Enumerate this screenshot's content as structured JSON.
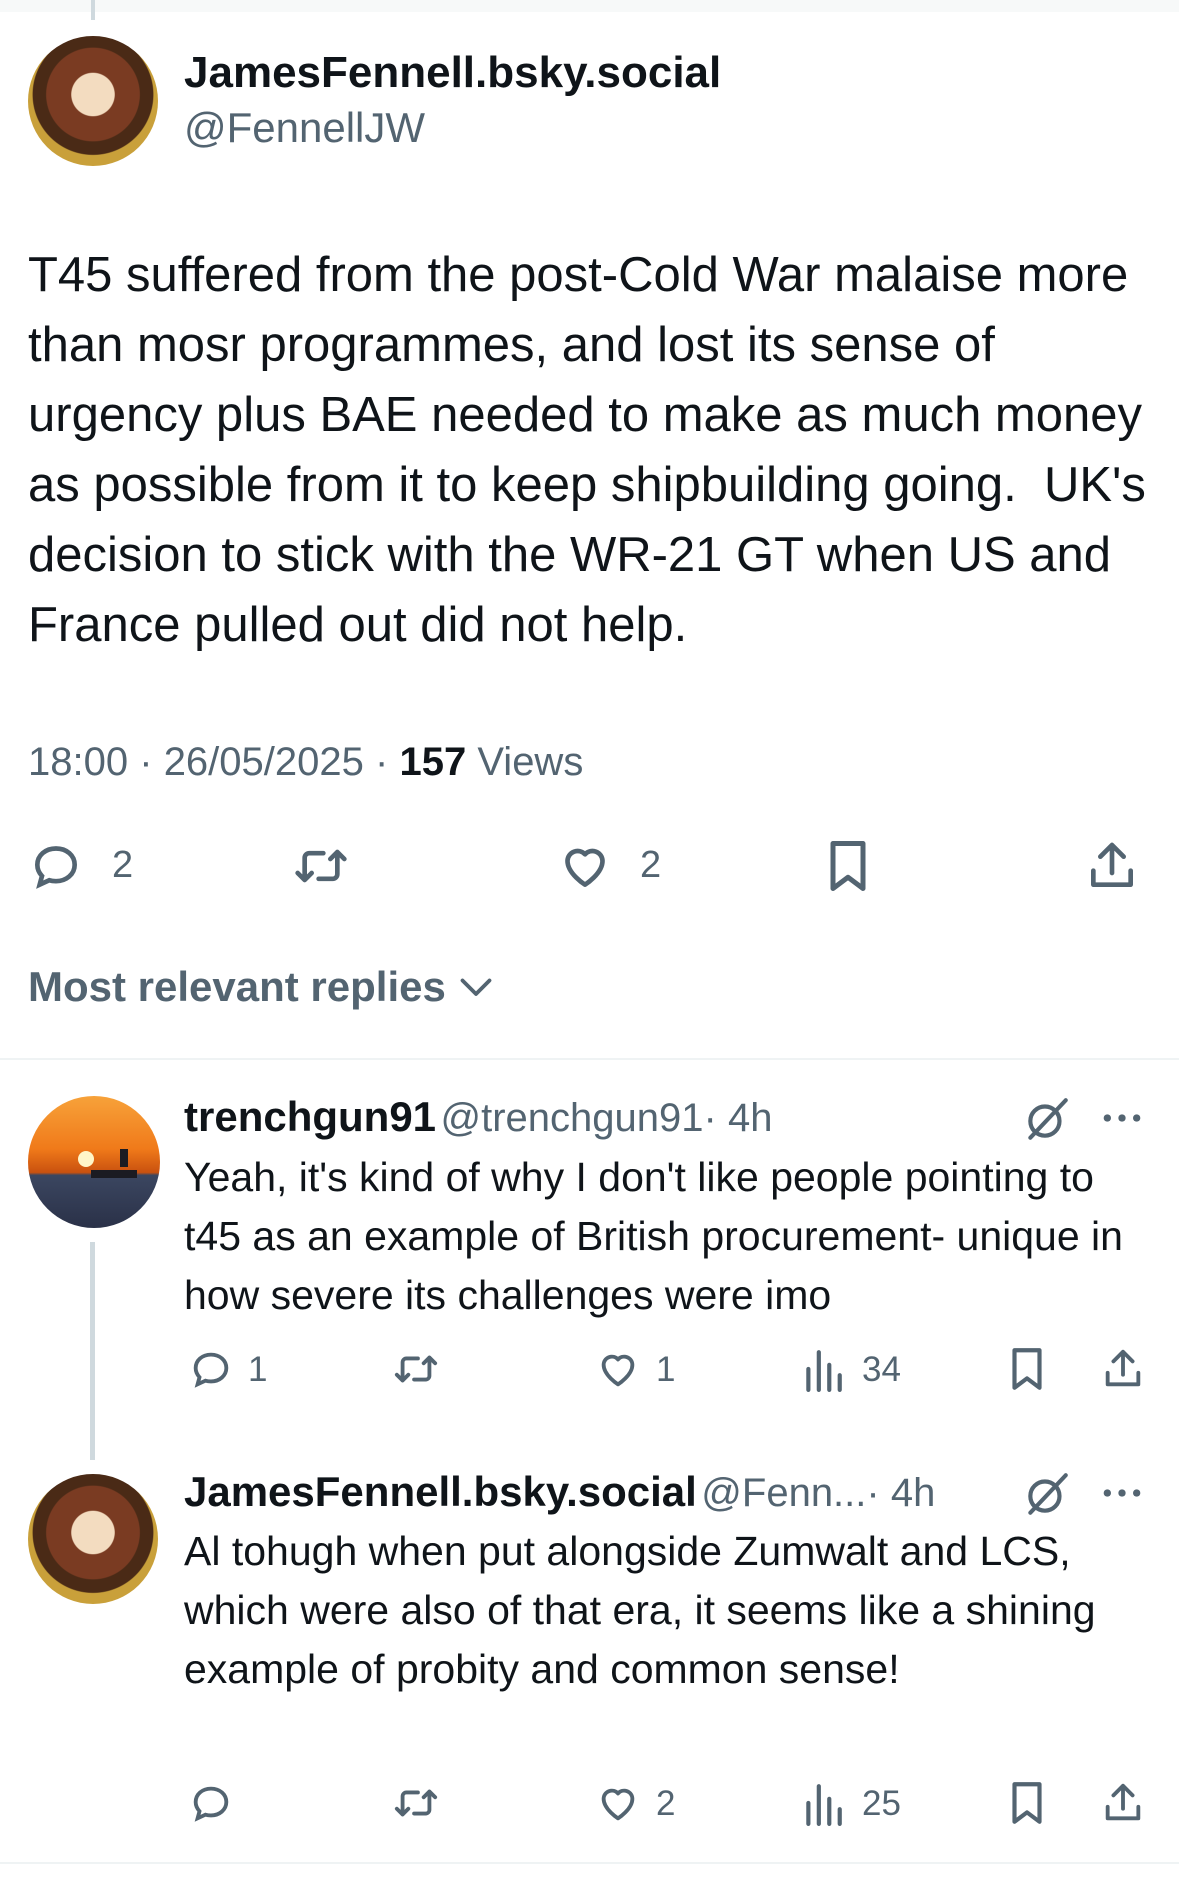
{
  "post": {
    "display_name": "JamesFennell.bsky.social",
    "handle": "@FennellJW",
    "text": "T45 suffered from the post-Cold War malaise more than mosr programmes, and lost its sense of urgency plus BAE needed to make as much money as possible from it to keep shipbuilding going.  UK's decision to stick with the WR-21 GT when US and France pulled out did not help.",
    "time": "18:00",
    "date": "26/05/2025",
    "separator": "·",
    "views_count": "157",
    "views_label": "Views",
    "replies": "2",
    "likes": "2"
  },
  "sort_label": "Most relevant replies",
  "replies": [
    {
      "display_name": "trenchgun91",
      "handle": "@trenchgun91",
      "age": "· 4h",
      "text": "Yeah, it's kind of why I don't like people pointing to t45 as an example of British procurement- unique in how severe its challenges were imo",
      "replies": "1",
      "likes": "1",
      "views": "34"
    },
    {
      "display_name": "JamesFennell.bsky.social",
      "handle": "@Fenn...",
      "age": "· 4h",
      "text": "Al tohugh when put alongside Zumwalt and LCS, which were also of that era, it seems like a shining example of probity and common sense!",
      "replies": "",
      "likes": "2",
      "views": "25"
    }
  ],
  "icons": {
    "reply": "reply-icon",
    "retweet": "retweet-icon",
    "like": "heart-icon",
    "bookmark": "bookmark-icon",
    "share": "share-icon",
    "views": "views-icon",
    "grok": "grok-icon",
    "more": "more-icon",
    "chevron": "chevron-down-icon"
  },
  "colors": {
    "text": "#0f1419",
    "secondary": "#536471",
    "divider": "#eff3f4"
  }
}
